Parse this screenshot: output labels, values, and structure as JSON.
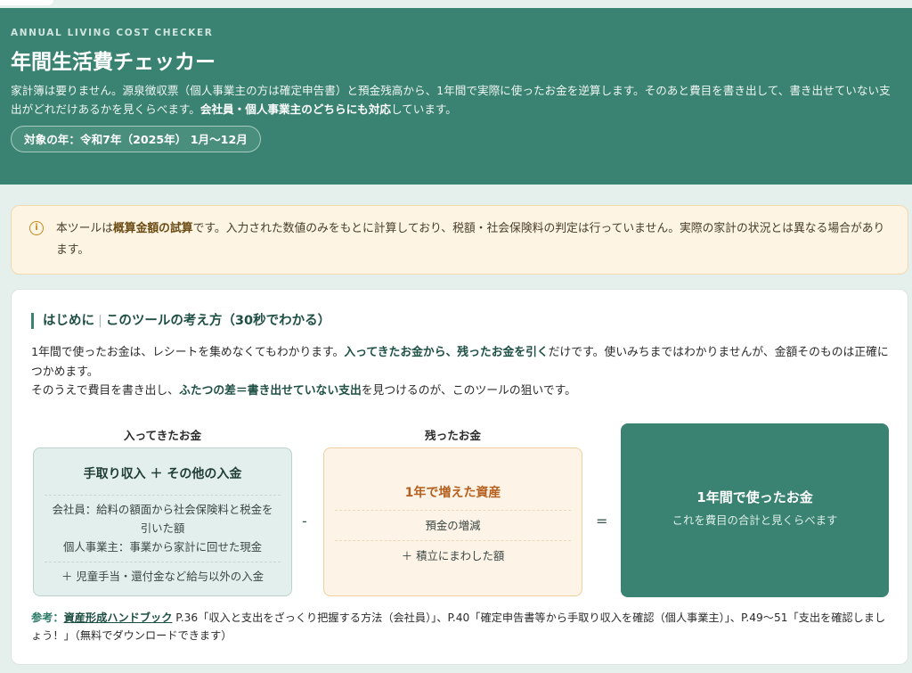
{
  "header": {
    "eyebrow": "ANNUAL LIVING COST CHECKER",
    "title": "年間生活費チェッカー",
    "desc_1": "家計簿は要りません。源泉徴収票（個人事業主の方は確定申告書）と預金残高から、1年間で実際に使ったお金を逆算します。そのあと費目を書き出して、書き出せていない支出がどれだけあるかを見くらべます。",
    "desc_bold": "会社員・個人事業主のどちらにも対応",
    "desc_2": "しています。",
    "year_pill": "対象の年：令和7年（2025年） 1月〜12月"
  },
  "notice": {
    "icon": "info-icon",
    "text_1": "本ツールは",
    "text_bold": "概算金額の試算",
    "text_2": "です。入力された数値のみをもとに計算しており、税額・社会保険料の判定は行っていません。実際の家計の状況とは異なる場合があります。"
  },
  "section": {
    "title_a": "はじめに",
    "title_sep": "|",
    "title_b": "このツールの考え方（30秒でわかる）",
    "p1_a": "1年間で使ったお金は、レシートを集めなくてもわかります。",
    "p1_bold": "入ってきたお金から、残ったお金を引く",
    "p1_b": "だけです。使いみちまではわかりませんが、金額そのものは正確につかめます。",
    "p2_a": "そのうえで費目を書き出し、",
    "p2_bold": "ふたつの差＝書き出せていない支出",
    "p2_b": "を見つけるのが、このツールの狙いです。"
  },
  "formula": {
    "label_in": "入ってきたお金",
    "label_left": "残ったお金",
    "in_title": "手取り収入 ＋ その他の入金",
    "in_line_1": "会社員：給料の額面から社会保険料と税金を引いた額",
    "in_line_2": "個人事業主：事業から家計に回せた現金",
    "in_line_3": "＋ 児童手当・還付金など給与以外の入金",
    "minus": "-",
    "left_title": "1年で増えた資産",
    "left_line_1": "預金の増減",
    "left_line_2": "＋ 積立にまわした額",
    "equals": "=",
    "result_title": "1年間で使ったお金",
    "result_sub": "これを費目の合計と見くらべます"
  },
  "reference": {
    "label": "参考：",
    "book": "資産形成ハンドブック",
    "text": " P.36「収入と支出をざっくり把握する方法（会社員）」、P.40「確定申告書等から手取り収入を確認（個人事業主）」、P.49〜51「支出を確認しましょう！」（無料でダウンロードできます）"
  },
  "colors": {
    "header_bg": "#3a8271",
    "notice_bg": "#fdf4e3",
    "accent_orange": "#b5601e"
  }
}
